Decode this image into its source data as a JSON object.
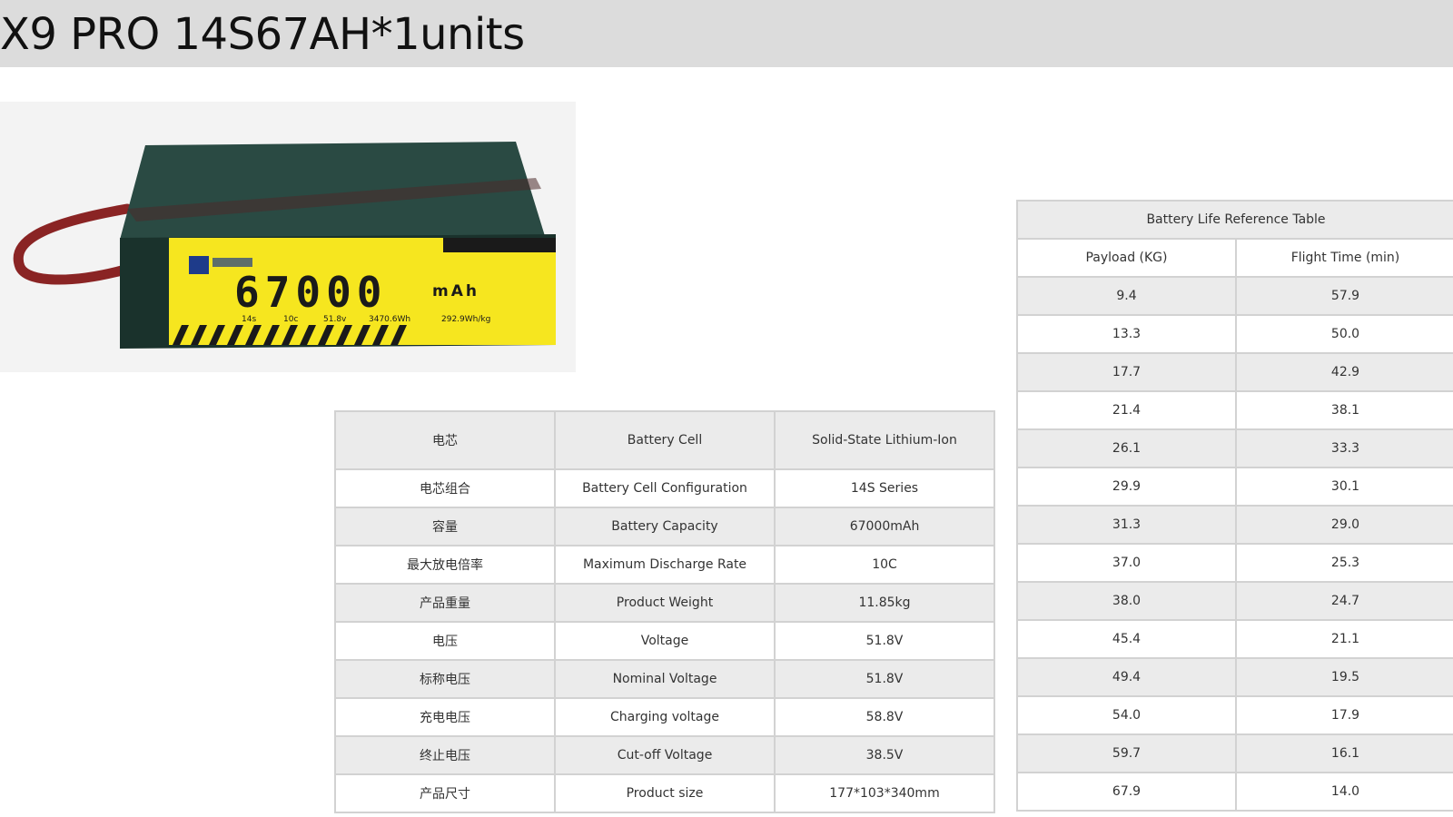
{
  "header": {
    "title": "X9 PRO 14S67AH*1units"
  },
  "product_image": {
    "label_capacity": "67000",
    "label_unit": "mAh",
    "label_specs": [
      "14s",
      "10c",
      "51.8v",
      "3470.6Wh",
      "292.9Wh/kg"
    ],
    "colors": {
      "body": "#1d3a34",
      "label": "#f6e61f",
      "strap": "#8a2424"
    }
  },
  "spec_table": {
    "header": [
      "电芯",
      "Battery Cell",
      "Solid-State Lithium-Ion"
    ],
    "rows": [
      [
        "电芯组合",
        "Battery Cell Configuration",
        "14S Series"
      ],
      [
        "容量",
        "Battery Capacity",
        "67000mAh"
      ],
      [
        "最大放电倍率",
        "Maximum Discharge Rate",
        "10C"
      ],
      [
        "产品重量",
        "Product Weight",
        "11.85kg"
      ],
      [
        "电压",
        "Voltage",
        "51.8V"
      ],
      [
        "标称电压",
        "Nominal Voltage",
        "51.8V"
      ],
      [
        "充电电压",
        "Charging voltage",
        "58.8V"
      ],
      [
        "终止电压",
        "Cut-off Voltage",
        "38.5V"
      ],
      [
        "产品尺寸",
        "Product size",
        "177*103*340mm"
      ]
    ]
  },
  "life_table": {
    "title": "Battery Life Reference Table",
    "columns": [
      "Payload (KG)",
      "Flight Time (min)"
    ],
    "rows": [
      [
        "9.4",
        "57.9"
      ],
      [
        "13.3",
        "50.0"
      ],
      [
        "17.7",
        "42.9"
      ],
      [
        "21.4",
        "38.1"
      ],
      [
        "26.1",
        "33.3"
      ],
      [
        "29.9",
        "30.1"
      ],
      [
        "31.3",
        "29.0"
      ],
      [
        "37.0",
        "25.3"
      ],
      [
        "38.0",
        "24.7"
      ],
      [
        "45.4",
        "21.1"
      ],
      [
        "49.4",
        "19.5"
      ],
      [
        "54.0",
        "17.9"
      ],
      [
        "59.7",
        "16.1"
      ],
      [
        "67.9",
        "14.0"
      ]
    ]
  }
}
